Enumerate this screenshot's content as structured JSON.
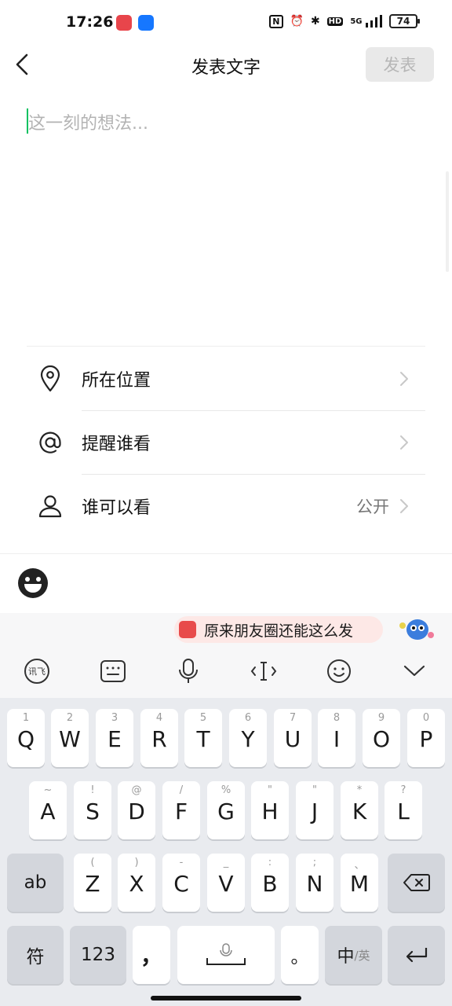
{
  "status_bar": {
    "time": "17:26",
    "network": "5G",
    "hd": "HD",
    "battery": "74",
    "nfc": "N"
  },
  "header": {
    "title": "发表文字",
    "publish_label": "发表"
  },
  "editor": {
    "placeholder": "这一刻的想法..."
  },
  "options": [
    {
      "icon": "location-pin-icon",
      "label": "所在位置",
      "value": ""
    },
    {
      "icon": "at-sign-icon",
      "label": "提醒谁看",
      "value": ""
    },
    {
      "icon": "person-icon",
      "label": "谁可以看",
      "value": "公开"
    }
  ],
  "keyboard": {
    "suggestion": "原来朋友圈还能这么发",
    "toolbar": {
      "ifly": "讯飞"
    },
    "row1": [
      {
        "sub": "1",
        "key": "Q"
      },
      {
        "sub": "2",
        "key": "W"
      },
      {
        "sub": "3",
        "key": "E"
      },
      {
        "sub": "4",
        "key": "R"
      },
      {
        "sub": "5",
        "key": "T"
      },
      {
        "sub": "6",
        "key": "Y"
      },
      {
        "sub": "7",
        "key": "U"
      },
      {
        "sub": "8",
        "key": "I"
      },
      {
        "sub": "9",
        "key": "O"
      },
      {
        "sub": "0",
        "key": "P"
      }
    ],
    "row2": [
      {
        "sub": "~",
        "key": "A"
      },
      {
        "sub": "!",
        "key": "S"
      },
      {
        "sub": "@",
        "key": "D"
      },
      {
        "sub": "/",
        "key": "F"
      },
      {
        "sub": "%",
        "key": "G"
      },
      {
        "sub": "\"",
        "key": "H"
      },
      {
        "sub": "\"",
        "key": "J"
      },
      {
        "sub": "*",
        "key": "K"
      },
      {
        "sub": "?",
        "key": "L"
      }
    ],
    "row3": [
      {
        "sub": "(",
        "key": "Z"
      },
      {
        "sub": ")",
        "key": "X"
      },
      {
        "sub": "-",
        "key": "C"
      },
      {
        "sub": "_",
        "key": "V"
      },
      {
        "sub": ":",
        "key": "B"
      },
      {
        "sub": ";",
        "key": "N"
      },
      {
        "sub": "、",
        "key": "M"
      }
    ],
    "ab_label": "ab",
    "symbol_label": "符",
    "num_label": "123",
    "comma_label": "，",
    "period_label": "。",
    "lang_main": "中",
    "lang_sub": "/英"
  },
  "colors": {
    "accent_green": "#07c160",
    "publish_disabled_bg": "#e9e9e9",
    "publish_disabled_text": "#b6b6b6"
  }
}
